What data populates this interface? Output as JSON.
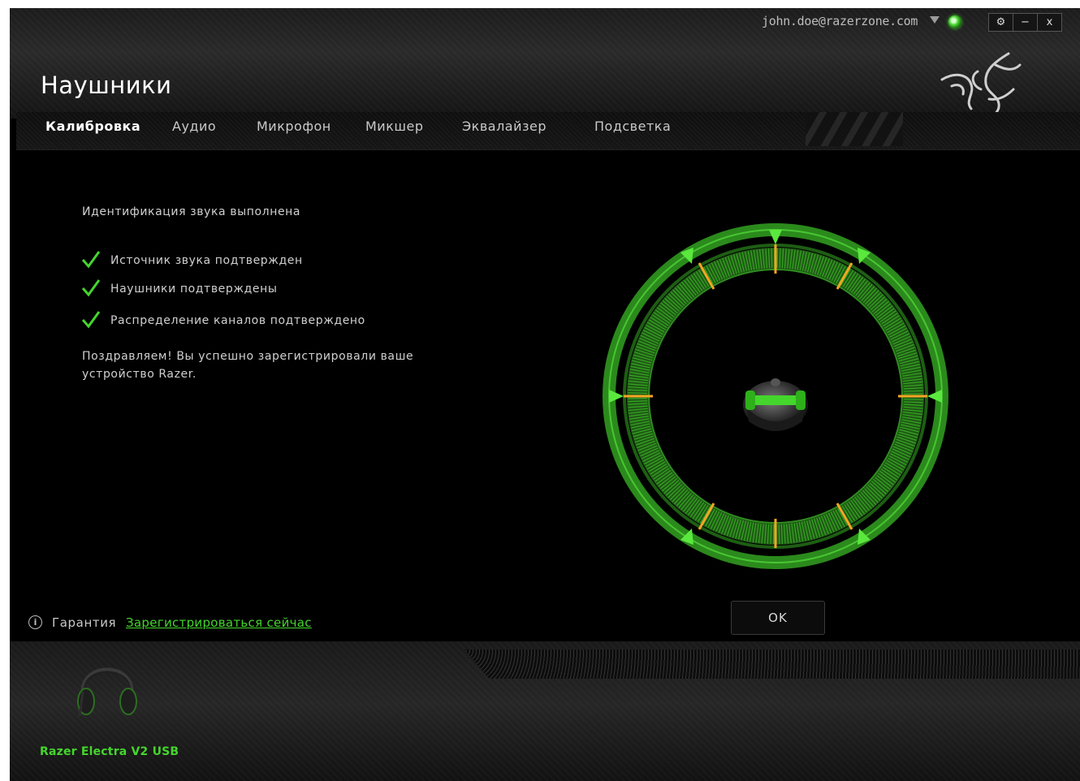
{
  "header": {
    "title": "Наушники",
    "account_email": "john.doe@razerzone.com",
    "window_buttons": {
      "settings": "⚙",
      "minimize": "−",
      "close": "x"
    }
  },
  "tabs": [
    {
      "label": "Калибровка",
      "active": true
    },
    {
      "label": "Аудио",
      "active": false
    },
    {
      "label": "Микрофон",
      "active": false
    },
    {
      "label": "Микшер",
      "active": false
    },
    {
      "label": "Эквалайзер",
      "active": false
    },
    {
      "label": "Подсветка",
      "active": false
    }
  ],
  "content": {
    "identification": "Идентификация звука выполнена",
    "checks": [
      "Источник звука подтвержден",
      "Наушники подтверждены",
      "Распределение каналов подтверждено"
    ],
    "congrats": "Поздравляем! Вы успешно зарегистрировали ваше устройство Razer.",
    "ok_label": "OK"
  },
  "warranty": {
    "label": "Гарантия",
    "link": "Зарегистрироваться сейчас"
  },
  "device": {
    "name": "Razer Electra V2 USB"
  },
  "colors": {
    "accent": "#44d62c",
    "marker": "#f5a623",
    "background": "#000000"
  },
  "icons": {
    "check": "check-icon",
    "info": "info-icon",
    "logo": "razer-logo-icon",
    "status": "status-orb-icon"
  }
}
